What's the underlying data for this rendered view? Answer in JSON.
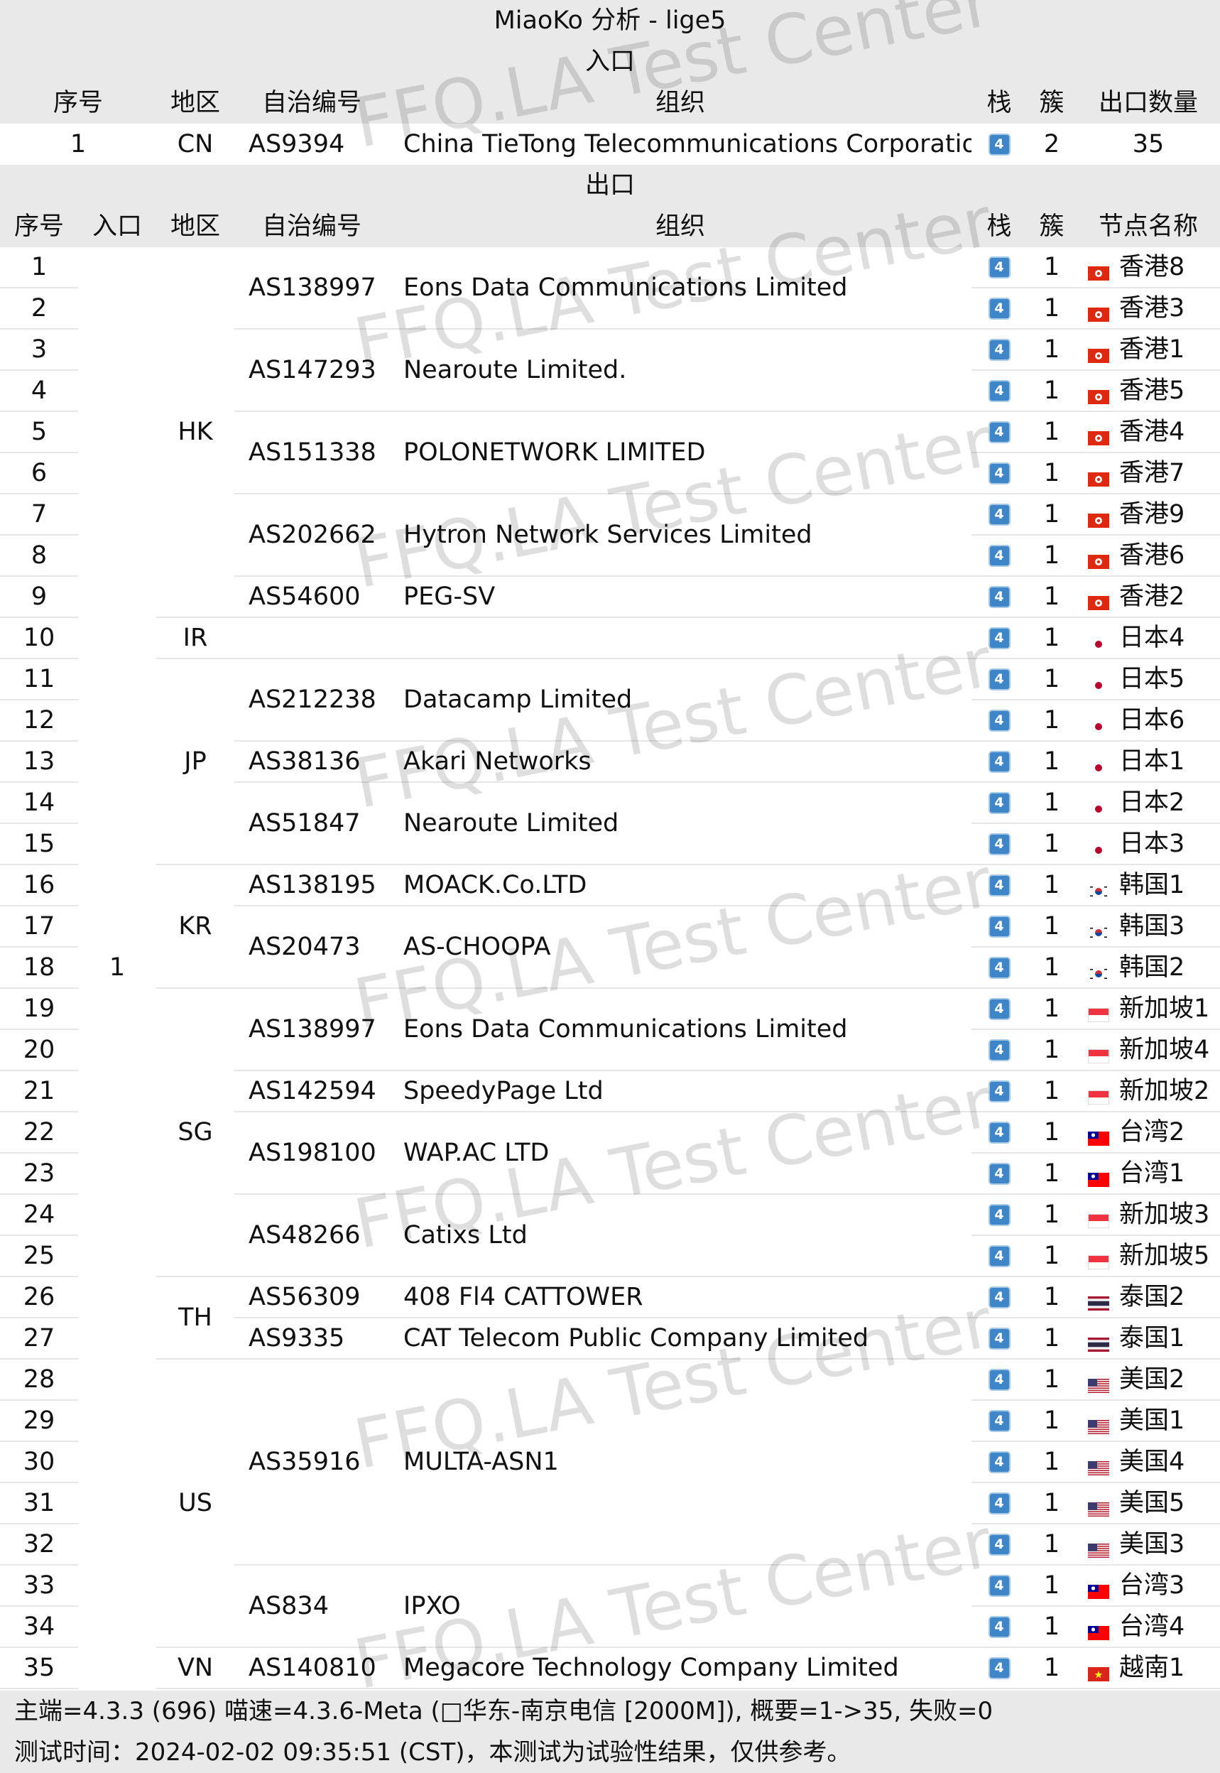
{
  "title": "MiaoKo 分析 - lige5",
  "entry_section": "入口",
  "entry_headers": [
    "序号",
    "地区",
    "自治编号",
    "组织",
    "栈",
    "簇",
    "出口数量"
  ],
  "entry_row": {
    "idx": "1",
    "region": "CN",
    "asn": "AS9394",
    "org": "China TieTong Telecommunications Corporation",
    "stack": "4",
    "cluster": "2",
    "exit_count": "35"
  },
  "exit_section": "出口",
  "exit_headers": [
    "序号",
    "入口",
    "地区",
    "自治编号",
    "组织",
    "栈",
    "簇",
    "节点名称"
  ],
  "exit_entry_value": "1",
  "stack_label": "4",
  "regions": [
    "HK",
    "IR",
    "JP",
    "KR",
    "SG",
    "TH",
    "US",
    "VN"
  ],
  "asns": [
    {
      "asn": "AS138997",
      "org": "Eons Data Communications Limited"
    },
    {
      "asn": "AS147293",
      "org": "Nearoute Limited."
    },
    {
      "asn": "AS151338",
      "org": "POLONETWORK LIMITED"
    },
    {
      "asn": "AS202662",
      "org": "Hytron Network Services Limited"
    },
    {
      "asn": "AS54600",
      "org": "PEG-SV"
    },
    {
      "asn": "",
      "org": ""
    },
    {
      "asn": "AS212238",
      "org": "Datacamp Limited"
    },
    {
      "asn": "AS38136",
      "org": "Akari Networks"
    },
    {
      "asn": "AS51847",
      "org": "Nearoute Limited"
    },
    {
      "asn": "AS138195",
      "org": "MOACK.Co.LTD"
    },
    {
      "asn": "AS20473",
      "org": "AS-CHOOPA"
    },
    {
      "asn": "AS138997",
      "org": "Eons Data Communications Limited"
    },
    {
      "asn": "AS142594",
      "org": "SpeedyPage Ltd"
    },
    {
      "asn": "AS198100",
      "org": "WAP.AC LTD"
    },
    {
      "asn": "AS48266",
      "org": "Catixs Ltd"
    },
    {
      "asn": "AS56309",
      "org": "408 Fl4 CATTOWER"
    },
    {
      "asn": "AS9335",
      "org": "CAT Telecom Public Company Limited"
    },
    {
      "asn": "AS35916",
      "org": "MULTA-ASN1"
    },
    {
      "asn": "AS834",
      "org": "IPXO"
    },
    {
      "asn": "AS140810",
      "org": "Megacore Technology Company Limited"
    }
  ],
  "rows": [
    {
      "idx": "1",
      "cluster": "1",
      "node": "香港8",
      "flag": "hk"
    },
    {
      "idx": "2",
      "cluster": "1",
      "node": "香港3",
      "flag": "hk"
    },
    {
      "idx": "3",
      "cluster": "1",
      "node": "香港1",
      "flag": "hk"
    },
    {
      "idx": "4",
      "cluster": "1",
      "node": "香港5",
      "flag": "hk"
    },
    {
      "idx": "5",
      "cluster": "1",
      "node": "香港4",
      "flag": "hk"
    },
    {
      "idx": "6",
      "cluster": "1",
      "node": "香港7",
      "flag": "hk"
    },
    {
      "idx": "7",
      "cluster": "1",
      "node": "香港9",
      "flag": "hk"
    },
    {
      "idx": "8",
      "cluster": "1",
      "node": "香港6",
      "flag": "hk"
    },
    {
      "idx": "9",
      "cluster": "1",
      "node": "香港2",
      "flag": "hk"
    },
    {
      "idx": "10",
      "cluster": "1",
      "node": "日本4",
      "flag": "jp"
    },
    {
      "idx": "11",
      "cluster": "1",
      "node": "日本5",
      "flag": "jp"
    },
    {
      "idx": "12",
      "cluster": "1",
      "node": "日本6",
      "flag": "jp"
    },
    {
      "idx": "13",
      "cluster": "1",
      "node": "日本1",
      "flag": "jp"
    },
    {
      "idx": "14",
      "cluster": "1",
      "node": "日本2",
      "flag": "jp"
    },
    {
      "idx": "15",
      "cluster": "1",
      "node": "日本3",
      "flag": "jp"
    },
    {
      "idx": "16",
      "cluster": "1",
      "node": "韩国1",
      "flag": "kr"
    },
    {
      "idx": "17",
      "cluster": "1",
      "node": "韩国3",
      "flag": "kr"
    },
    {
      "idx": "18",
      "cluster": "1",
      "node": "韩国2",
      "flag": "kr"
    },
    {
      "idx": "19",
      "cluster": "1",
      "node": "新加坡1",
      "flag": "sg"
    },
    {
      "idx": "20",
      "cluster": "1",
      "node": "新加坡4",
      "flag": "sg"
    },
    {
      "idx": "21",
      "cluster": "1",
      "node": "新加坡2",
      "flag": "sg"
    },
    {
      "idx": "22",
      "cluster": "1",
      "node": "台湾2",
      "flag": "tw"
    },
    {
      "idx": "23",
      "cluster": "1",
      "node": "台湾1",
      "flag": "tw"
    },
    {
      "idx": "24",
      "cluster": "1",
      "node": "新加坡3",
      "flag": "sg"
    },
    {
      "idx": "25",
      "cluster": "1",
      "node": "新加坡5",
      "flag": "sg"
    },
    {
      "idx": "26",
      "cluster": "1",
      "node": "泰国2",
      "flag": "th"
    },
    {
      "idx": "27",
      "cluster": "1",
      "node": "泰国1",
      "flag": "th"
    },
    {
      "idx": "28",
      "cluster": "1",
      "node": "美国2",
      "flag": "us"
    },
    {
      "idx": "29",
      "cluster": "1",
      "node": "美国1",
      "flag": "us"
    },
    {
      "idx": "30",
      "cluster": "1",
      "node": "美国4",
      "flag": "us"
    },
    {
      "idx": "31",
      "cluster": "1",
      "node": "美国5",
      "flag": "us"
    },
    {
      "idx": "32",
      "cluster": "1",
      "node": "美国3",
      "flag": "us"
    },
    {
      "idx": "33",
      "cluster": "1",
      "node": "台湾3",
      "flag": "tw"
    },
    {
      "idx": "34",
      "cluster": "1",
      "node": "台湾4",
      "flag": "tw"
    },
    {
      "idx": "35",
      "cluster": "1",
      "node": "越南1",
      "flag": "vn"
    }
  ],
  "footer_line1": "主端=4.3.3 (696) 喵速=4.3.6-Meta (□华东-南京电信 [2000M]), 概要=1->35, 失败=0",
  "footer_line2": "测试时间：2024-02-02 09:35:51 (CST)，本测试为试验性结果，仅供参考。",
  "watermark": "FFQ.LA Test Center"
}
